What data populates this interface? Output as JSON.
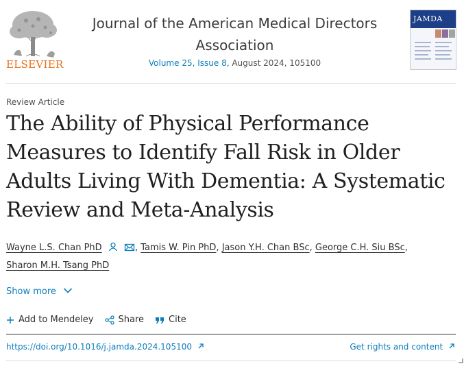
{
  "publisher": {
    "wordmark": "ELSEVIER"
  },
  "journal": {
    "title": "Journal of the American Medical Directors Association",
    "volume_link": "Volume 25, Issue 8",
    "date_article": ", August 2024, 105100",
    "cover_title": "JAMDA"
  },
  "article": {
    "type": "Review Article",
    "title": "The Ability of Physical Performance Measures to Identify Fall Risk in Older Adults Living With Dementia: A Systematic Review and Meta-Analysis"
  },
  "authors": [
    "Wayne L.S. Chan PhD",
    "Tamis W. Pin PhD",
    "Jason Y.H. Chan BSc",
    "George C.H. Siu BSc",
    "Sharon M.H. Tsang PhD"
  ],
  "show_more": "Show more",
  "actions": {
    "mendeley": "Add to Mendeley",
    "share": "Share",
    "cite": "Cite"
  },
  "doi": "https://doi.org/10.1016/j.jamda.2024.105100",
  "rights": "Get rights and content",
  "colors": {
    "link": "#0c7dbb",
    "brand": "#e9711c"
  }
}
